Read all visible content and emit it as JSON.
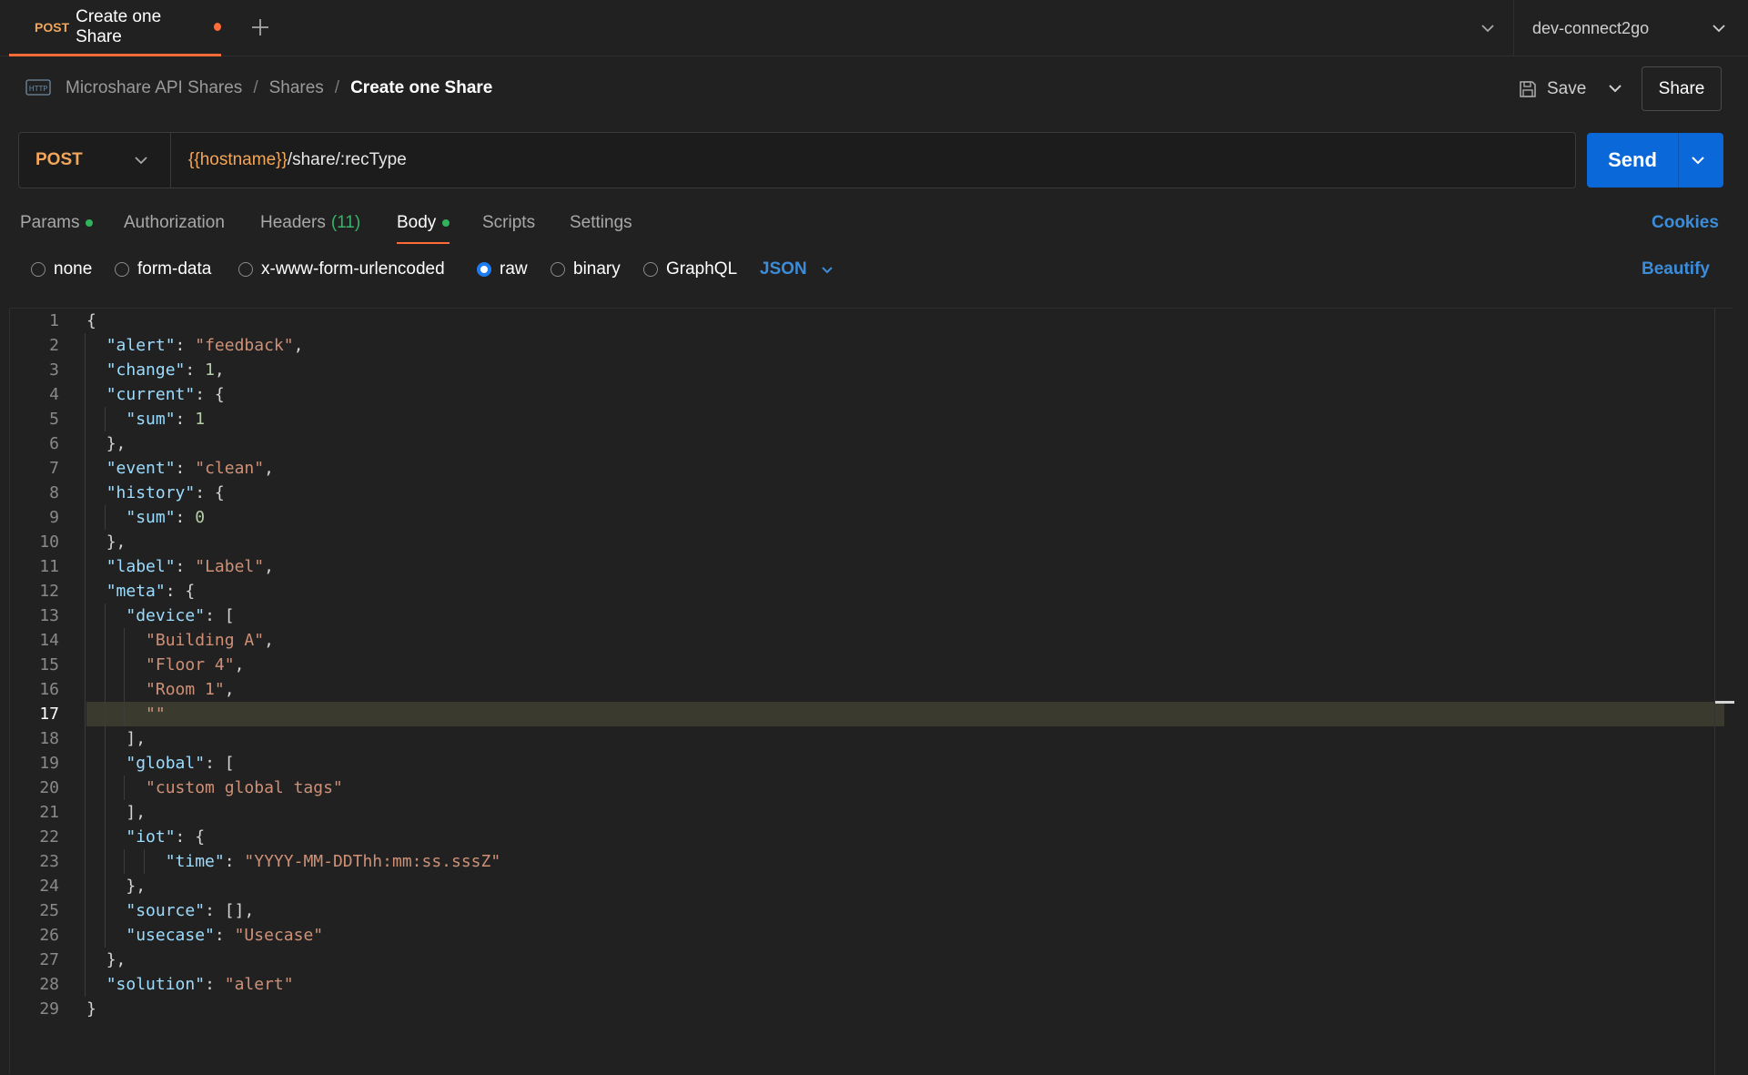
{
  "tab": {
    "method": "POST",
    "title": "Create one Share"
  },
  "environment": {
    "name": "dev-connect2go"
  },
  "breadcrumb": {
    "items": [
      "Microshare API Shares",
      "Shares"
    ],
    "current": "Create one Share",
    "separator": "/"
  },
  "toolbar": {
    "save_label": "Save",
    "share_label": "Share"
  },
  "request": {
    "method": "POST",
    "url_var": "{{hostname}}",
    "url_path": "/share/:recType",
    "send_label": "Send"
  },
  "request_tabs": [
    {
      "label": "Params",
      "dot": true
    },
    {
      "label": "Authorization"
    },
    {
      "label": "Headers",
      "count": "(11)"
    },
    {
      "label": "Body",
      "dot": true,
      "active": true
    },
    {
      "label": "Scripts"
    },
    {
      "label": "Settings"
    }
  ],
  "cookies_label": "Cookies",
  "body_options": {
    "items": [
      "none",
      "form-data",
      "x-www-form-urlencoded",
      "raw",
      "binary",
      "GraphQL"
    ],
    "selected": "raw",
    "format": "JSON",
    "beautify_label": "Beautify"
  },
  "editor": {
    "highlighted_line": 17,
    "lines": [
      "{",
      "  \"alert\": \"feedback\",",
      "  \"change\": 1,",
      "  \"current\": {",
      "    \"sum\": 1",
      "  },",
      "  \"event\": \"clean\",",
      "  \"history\": {",
      "    \"sum\": 0",
      "  },",
      "  \"label\": \"Label\",",
      "  \"meta\": {",
      "    \"device\": [",
      "      \"Building A\",",
      "      \"Floor 4\",",
      "      \"Room 1\",",
      "      \"\"",
      "    ],",
      "    \"global\": [",
      "      \"custom global tags\"",
      "    ],",
      "    \"iot\": {",
      "        \"time\": \"YYYY-MM-DDThh:mm:ss.sssZ\"",
      "    },",
      "    \"source\": [],",
      "    \"usecase\": \"Usecase\"",
      "  },",
      "  \"solution\": \"alert\"",
      "}"
    ]
  },
  "colors": {
    "accent": "#ff6c37",
    "send": "#0b68d9",
    "link": "#3b8ddb",
    "method": "#f1a65a",
    "ok": "#2fb45c"
  }
}
